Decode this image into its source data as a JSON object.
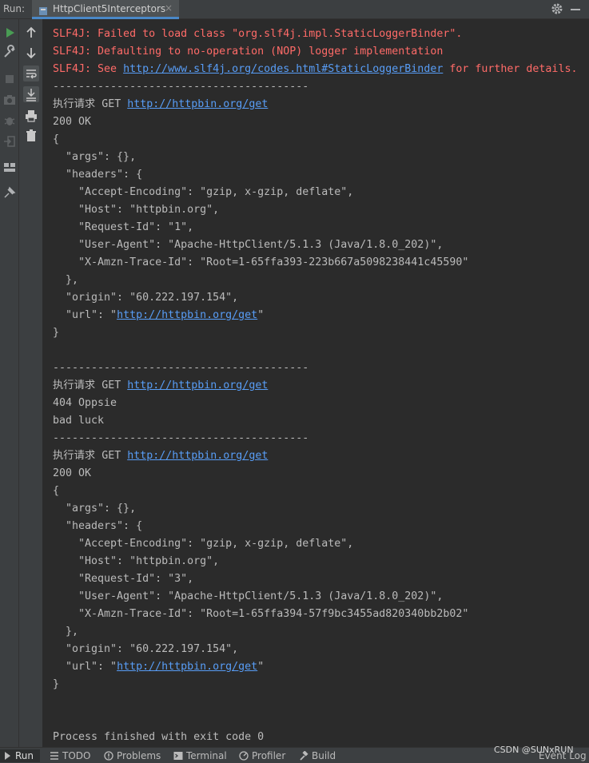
{
  "toolwindow": {
    "label": "Run:",
    "tab_title": "HttpClient5Interceptors",
    "close_glyph": "×"
  },
  "toolbar_icons": [
    "rerun-icon",
    "wrench-icon",
    "stop-icon",
    "camera-icon",
    "debug-icon",
    "exit-icon",
    "layout-icon",
    "pin-icon",
    "up-arrow-icon",
    "down-arrow-icon",
    "soft-wrap-icon",
    "scroll-to-end-icon",
    "print-icon",
    "trash-icon"
  ],
  "console": {
    "lines": [
      {
        "text": "SLF4J: Failed to load class \"org.slf4j.impl.StaticLoggerBinder\".",
        "kind": "err"
      },
      {
        "text": "SLF4J: Defaulting to no-operation (NOP) logger implementation",
        "kind": "err"
      },
      {
        "prefix": "SLF4J: See ",
        "link": "http://www.slf4j.org/codes.html#StaticLoggerBinder",
        "suffix": " for further details.",
        "kind": "err"
      },
      {
        "text": "----------------------------------------",
        "kind": "out"
      },
      {
        "prefix": "执行请求 GET ",
        "link": "http://httpbin.org/get",
        "suffix": "",
        "kind": "out"
      },
      {
        "text": "200 OK",
        "kind": "out"
      },
      {
        "text": "{",
        "kind": "out"
      },
      {
        "text": "  \"args\": {},",
        "kind": "out"
      },
      {
        "text": "  \"headers\": {",
        "kind": "out"
      },
      {
        "text": "    \"Accept-Encoding\": \"gzip, x-gzip, deflate\",",
        "kind": "out"
      },
      {
        "text": "    \"Host\": \"httpbin.org\",",
        "kind": "out"
      },
      {
        "text": "    \"Request-Id\": \"1\",",
        "kind": "out"
      },
      {
        "text": "    \"User-Agent\": \"Apache-HttpClient/5.1.3 (Java/1.8.0_202)\",",
        "kind": "out"
      },
      {
        "text": "    \"X-Amzn-Trace-Id\": \"Root=1-65ffa393-223b667a5098238441c45590\"",
        "kind": "out"
      },
      {
        "text": "  },",
        "kind": "out"
      },
      {
        "text": "  \"origin\": \"60.222.197.154\",",
        "kind": "out"
      },
      {
        "prefix": "  \"url\": \"",
        "link": "http://httpbin.org/get",
        "suffix": "\"",
        "kind": "out"
      },
      {
        "text": "}",
        "kind": "out"
      },
      {
        "text": "",
        "kind": "out"
      },
      {
        "text": "----------------------------------------",
        "kind": "out"
      },
      {
        "prefix": "执行请求 GET ",
        "link": "http://httpbin.org/get",
        "suffix": "",
        "kind": "out"
      },
      {
        "text": "404 Oppsie",
        "kind": "out"
      },
      {
        "text": "bad luck",
        "kind": "out"
      },
      {
        "text": "----------------------------------------",
        "kind": "out"
      },
      {
        "prefix": "执行请求 GET ",
        "link": "http://httpbin.org/get",
        "suffix": "",
        "kind": "out"
      },
      {
        "text": "200 OK",
        "kind": "out"
      },
      {
        "text": "{",
        "kind": "out"
      },
      {
        "text": "  \"args\": {},",
        "kind": "out"
      },
      {
        "text": "  \"headers\": {",
        "kind": "out"
      },
      {
        "text": "    \"Accept-Encoding\": \"gzip, x-gzip, deflate\",",
        "kind": "out"
      },
      {
        "text": "    \"Host\": \"httpbin.org\",",
        "kind": "out"
      },
      {
        "text": "    \"Request-Id\": \"3\",",
        "kind": "out"
      },
      {
        "text": "    \"User-Agent\": \"Apache-HttpClient/5.1.3 (Java/1.8.0_202)\",",
        "kind": "out"
      },
      {
        "text": "    \"X-Amzn-Trace-Id\": \"Root=1-65ffa394-57f9bc3455ad820340bb2b02\"",
        "kind": "out"
      },
      {
        "text": "  },",
        "kind": "out"
      },
      {
        "text": "  \"origin\": \"60.222.197.154\",",
        "kind": "out"
      },
      {
        "prefix": "  \"url\": \"",
        "link": "http://httpbin.org/get",
        "suffix": "\"",
        "kind": "out"
      },
      {
        "text": "}",
        "kind": "out"
      },
      {
        "text": "",
        "kind": "out"
      },
      {
        "text": "",
        "kind": "out"
      },
      {
        "text": "Process finished with exit code 0",
        "kind": "out"
      }
    ]
  },
  "bottom_bar": {
    "items": [
      {
        "label": "Run",
        "icon": "play-icon"
      },
      {
        "label": "TODO",
        "icon": "list-icon"
      },
      {
        "label": "Problems",
        "icon": "problems-icon"
      },
      {
        "label": "Terminal",
        "icon": "terminal-icon"
      },
      {
        "label": "Profiler",
        "icon": "profiler-icon"
      },
      {
        "label": "Build",
        "icon": "hammer-icon"
      }
    ],
    "event_log": "Event Log"
  },
  "watermark": "CSDN @SUNxRUN",
  "colors": {
    "error_text": "#ff6b68",
    "normal_text": "#bbbbbb",
    "link": "#589df6",
    "background": "#2b2b2b",
    "panel": "#3c3f41",
    "run_green": "#499c54"
  }
}
